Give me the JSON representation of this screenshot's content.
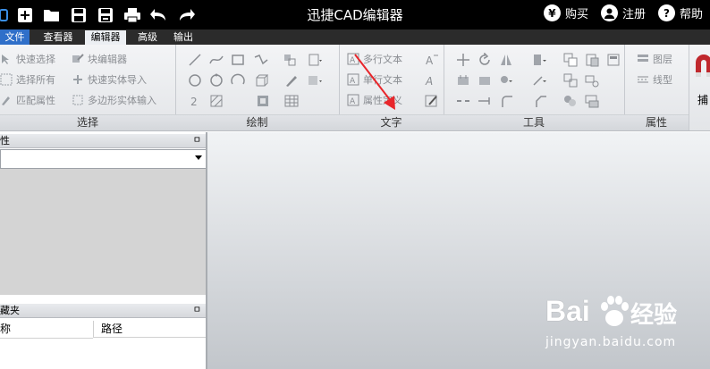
{
  "window": {
    "title": "迅捷CAD编辑器"
  },
  "topbar": {
    "buy_symbol": "¥",
    "buy": "购买",
    "register": "注册",
    "help_symbol": "?",
    "help": "帮助"
  },
  "menu": {
    "tabs": [
      {
        "label": "文件"
      },
      {
        "label": "查看器"
      },
      {
        "label": "编辑器"
      },
      {
        "label": "高级"
      },
      {
        "label": "输出"
      }
    ]
  },
  "ribbon": {
    "select": {
      "label": "选择",
      "items": [
        {
          "label": "快速选择"
        },
        {
          "label": "选择所有"
        },
        {
          "label": "匹配属性"
        }
      ],
      "items2": [
        {
          "label": "块编辑器"
        },
        {
          "label": "快速实体导入"
        },
        {
          "label": "多边形实体输入"
        }
      ]
    },
    "draw": {
      "label": "绘制"
    },
    "text": {
      "label": "文字",
      "items": [
        {
          "label": "多行文本"
        },
        {
          "label": "单行文本"
        },
        {
          "label": "属性定义"
        }
      ]
    },
    "tools": {
      "label": "工具"
    },
    "props": {
      "label": "属性",
      "items": [
        {
          "label": "图层"
        },
        {
          "label": "线型"
        }
      ],
      "snap": "捕"
    }
  },
  "panels": {
    "properties": {
      "title": "性",
      "pin": "ㅁ"
    },
    "favorites": {
      "title": "藏夹",
      "pin": "ㅁ",
      "columns": [
        {
          "label": "称"
        },
        {
          "label": "路径"
        }
      ]
    }
  },
  "watermark": {
    "brand_left": "Bai",
    "brand_right": "经验",
    "url": "jingyan.baidu.com"
  },
  "colors": {
    "file_tab": "#2f6fc9",
    "active_tab": "#eceff3",
    "arrow": "#e8262b"
  }
}
